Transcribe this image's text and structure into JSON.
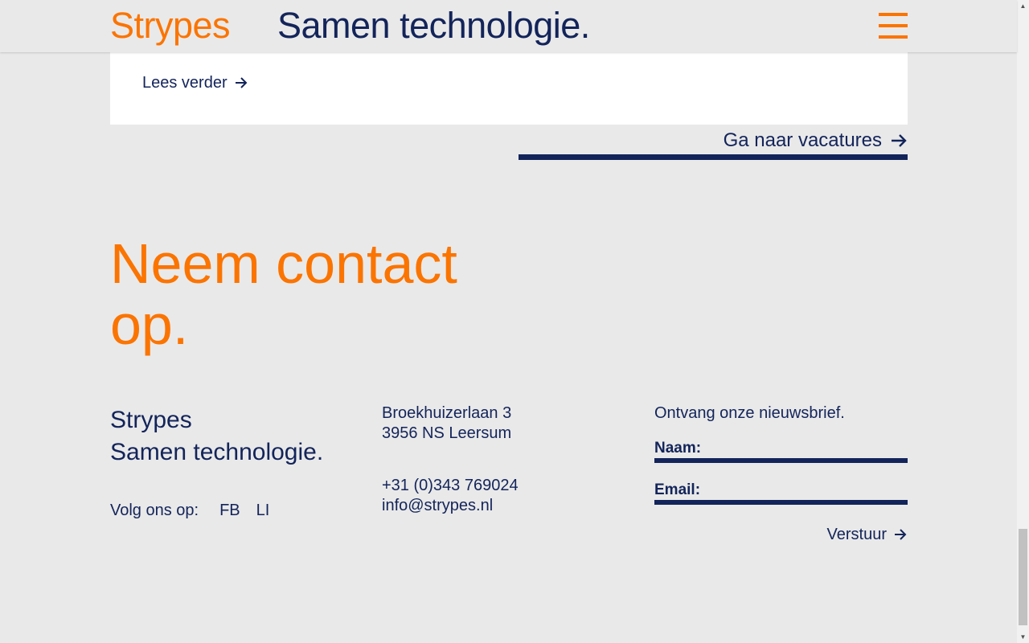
{
  "header": {
    "logo": "Strypes",
    "tagline": "Samen technologie.",
    "menu_icon": "hamburger-menu-icon"
  },
  "card": {
    "read_more_label": "Lees verder"
  },
  "vacatures": {
    "label": "Ga naar vacatures"
  },
  "contact": {
    "title": "Neem contact op."
  },
  "footer": {
    "brand_line1": "Strypes",
    "brand_line2": "Samen technologie.",
    "follow_label": "Volg ons op:",
    "social": [
      "FB",
      "LI"
    ],
    "address_line1": "Broekhuizerlaan 3",
    "address_line2": "3956 NS Leersum",
    "phone": "+31 (0)343 769024",
    "email": "info@strypes.nl"
  },
  "newsletter": {
    "title": "Ontvang onze nieuwsbrief.",
    "name_label": "Naam:",
    "email_label": "Email:",
    "submit_label": "Verstuur"
  },
  "colors": {
    "accent": "#fb7400",
    "primary": "#13245a",
    "background": "#e9e9e9"
  }
}
